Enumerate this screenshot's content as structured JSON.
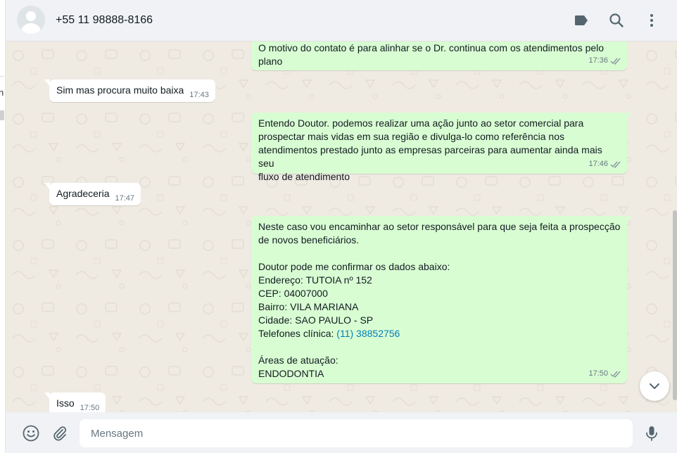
{
  "header": {
    "contact_name": "+55 11 98888-8166",
    "icons": [
      "avatar",
      "label-icon",
      "search-icon",
      "menu-icon"
    ]
  },
  "messages": [
    {
      "direction": "out",
      "lines": [
        "O motivo do contato é para alinhar se o Dr. continua com os atendimentos pelo",
        "plano"
      ],
      "time": "17:36",
      "status": "read"
    },
    {
      "direction": "in",
      "lines": [
        "Sim mas procura muito baixa"
      ],
      "time": "17:43"
    },
    {
      "direction": "out",
      "lines": [
        "Entendo Doutor. podemos realizar uma ação junto ao setor comercial para",
        "prospectar mais vidas em sua região e divulga-lo como referência nos",
        "atendimentos prestado junto as empresas parceiras para aumentar ainda mais seu",
        "fluxo de atendimento"
      ],
      "time": "17:46",
      "status": "read"
    },
    {
      "direction": "in",
      "lines": [
        "Agradeceria"
      ],
      "time": "17:47"
    },
    {
      "direction": "out",
      "lines": [
        "Neste caso vou encaminhar ao setor responsável para que seja feita a prospecção",
        "de novos beneficiários.",
        "",
        "Doutor pode me confirmar os dados abaixo:",
        "Endereço: TUTOIA nº 152",
        "CEP: 04007000",
        "Bairro: VILA MARIANA",
        "Cidade: SAO PAULO - SP"
      ],
      "phone_label": "Telefones clínica: ",
      "phone_link": "(11) 38852756",
      "tail_lines": [
        "",
        "Áreas de atuação:",
        "ENDODONTIA"
      ],
      "time": "17:50",
      "status": "read"
    },
    {
      "direction": "in",
      "lines": [
        "Isso"
      ],
      "time": "17:50"
    }
  ],
  "composer": {
    "placeholder": "Mensagem",
    "icons": [
      "emoji-icon",
      "attach-icon",
      "mic-icon"
    ]
  },
  "sidebar_fragment": {
    "char": "n"
  },
  "colors": {
    "outgoing_bubble": "#d9fdd3",
    "incoming_bubble": "#ffffff",
    "chat_background": "#efeae2",
    "header_background": "#f0f2f5",
    "link": "#027eb5",
    "read_tick": "#8696a0"
  }
}
